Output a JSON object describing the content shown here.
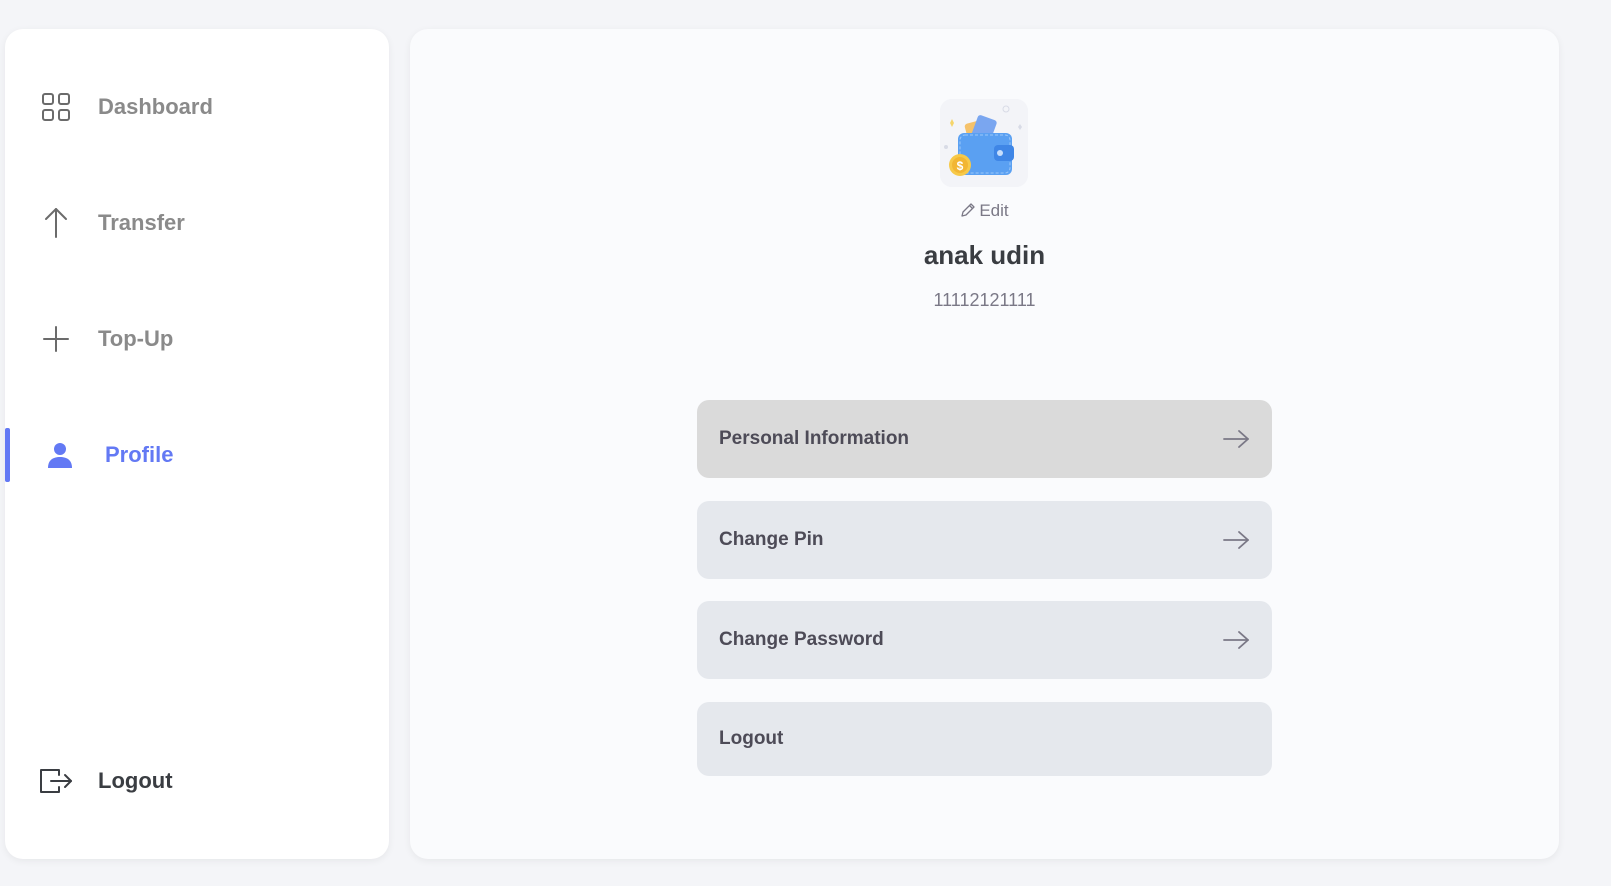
{
  "sidebar": {
    "items": [
      {
        "label": "Dashboard",
        "icon": "grid-icon"
      },
      {
        "label": "Transfer",
        "icon": "arrow-up-icon"
      },
      {
        "label": "Top-Up",
        "icon": "plus-icon"
      },
      {
        "label": "Profile",
        "icon": "user-icon",
        "active": true
      }
    ],
    "logout_label": "Logout"
  },
  "profile": {
    "edit_label": "Edit",
    "name": "anak udin",
    "phone": "11112121111"
  },
  "menu": {
    "items": [
      {
        "label": "Personal Information",
        "icon": "arrow-right-icon"
      },
      {
        "label": "Change Pin",
        "icon": "arrow-right-icon"
      },
      {
        "label": "Change Password",
        "icon": "arrow-right-icon"
      },
      {
        "label": "Logout"
      }
    ]
  },
  "colors": {
    "accent": "#6379f4",
    "text_dark": "#3a3d42",
    "text_muted": "#8a8a8a",
    "button_bg": "#e5e8ed",
    "button_hover_bg": "#dadada"
  }
}
